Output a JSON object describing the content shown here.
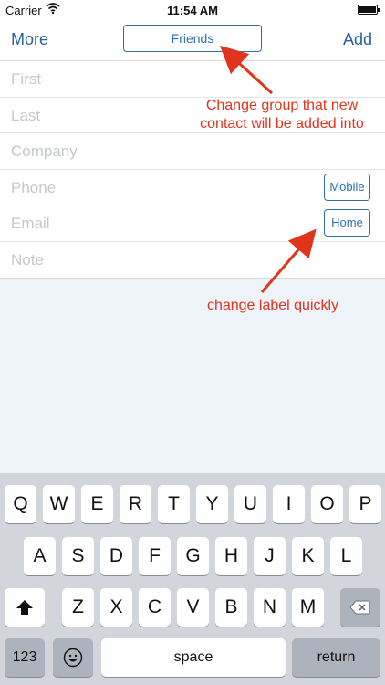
{
  "status_bar": {
    "carrier": "Carrier",
    "time": "11:54 AM"
  },
  "nav": {
    "left": "More",
    "group": "Friends",
    "right": "Add"
  },
  "form": {
    "fields": [
      {
        "placeholder": "First"
      },
      {
        "placeholder": "Last"
      },
      {
        "placeholder": "Company"
      },
      {
        "placeholder": "Phone",
        "label": "Mobile"
      },
      {
        "placeholder": "Email",
        "label": "Home"
      },
      {
        "placeholder": "Note"
      }
    ]
  },
  "annotations": {
    "group_line1": "Change group that new",
    "group_line2": "contact will be added into",
    "label_note": "change label quickly",
    "color": "#e0341c"
  },
  "keyboard": {
    "row1": [
      "Q",
      "W",
      "E",
      "R",
      "T",
      "Y",
      "U",
      "I",
      "O",
      "P"
    ],
    "row2": [
      "A",
      "S",
      "D",
      "F",
      "G",
      "H",
      "J",
      "K",
      "L"
    ],
    "row3": [
      "Z",
      "X",
      "C",
      "V",
      "B",
      "N",
      "M"
    ],
    "shift": "shift-icon",
    "delete": "delete-icon",
    "numbers": "123",
    "emoji": "emoji-icon",
    "space": "space",
    "return": "return"
  }
}
